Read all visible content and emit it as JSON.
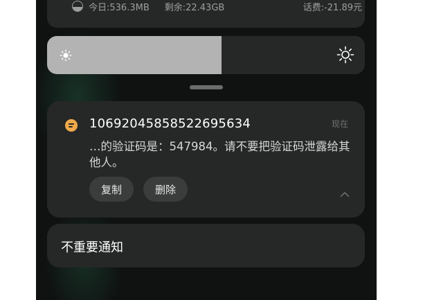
{
  "status_card": {
    "today_usage": "今日:536.3MB",
    "remaining": "剩余:22.43GB",
    "phone_balance": "话费:-21.89元",
    "icon": "data-usage-icon"
  },
  "brightness": {
    "level_fraction": 0.55,
    "low_icon": "brightness-low-icon",
    "high_icon": "brightness-high-icon"
  },
  "notification": {
    "app_icon": "message-icon",
    "sender": "10692045858522695634",
    "time": "现在",
    "body": "…的验证码是：547984。请不要把验证码泄露给其他人。",
    "actions": {
      "copy": "复制",
      "delete": "删除"
    },
    "collapse_icon": "chevron-up-icon"
  },
  "unimportant_notifications": {
    "label": "不重要通知"
  },
  "colors": {
    "background": "#0f1211",
    "card": "#262827",
    "accent_icon": "#f0a94a",
    "brightness_fill": "#b3b3b3"
  }
}
